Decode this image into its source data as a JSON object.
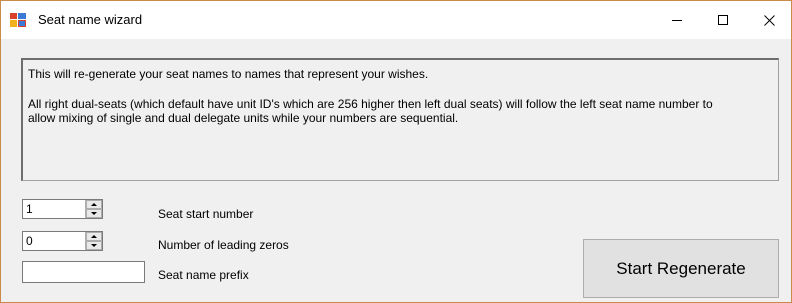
{
  "window": {
    "title": "Seat name wizard",
    "icon": "app-icon",
    "controls": {
      "minimize": "minimize-icon",
      "maximize": "maximize-icon",
      "close": "close-icon"
    }
  },
  "info": {
    "line1": "This will re-generate your seat names to names that represent your wishes.",
    "line2": "All right dual-seats (which default have unit ID's which are 256 higher then left dual seats) will follow the left seat name number to",
    "line3": "allow mixing of single and dual delegate units while your numbers are sequential."
  },
  "form": {
    "start_number": {
      "value": "1",
      "label": "Seat start number"
    },
    "leading_zeros": {
      "value": "0",
      "label": "Number of leading zeros"
    },
    "prefix": {
      "value": "",
      "label": "Seat name prefix"
    }
  },
  "actions": {
    "start_label": "Start Regenerate"
  },
  "colors": {
    "window_border": "#c98a4a",
    "background": "#f0f0f0",
    "button_face": "#e1e1e1"
  }
}
